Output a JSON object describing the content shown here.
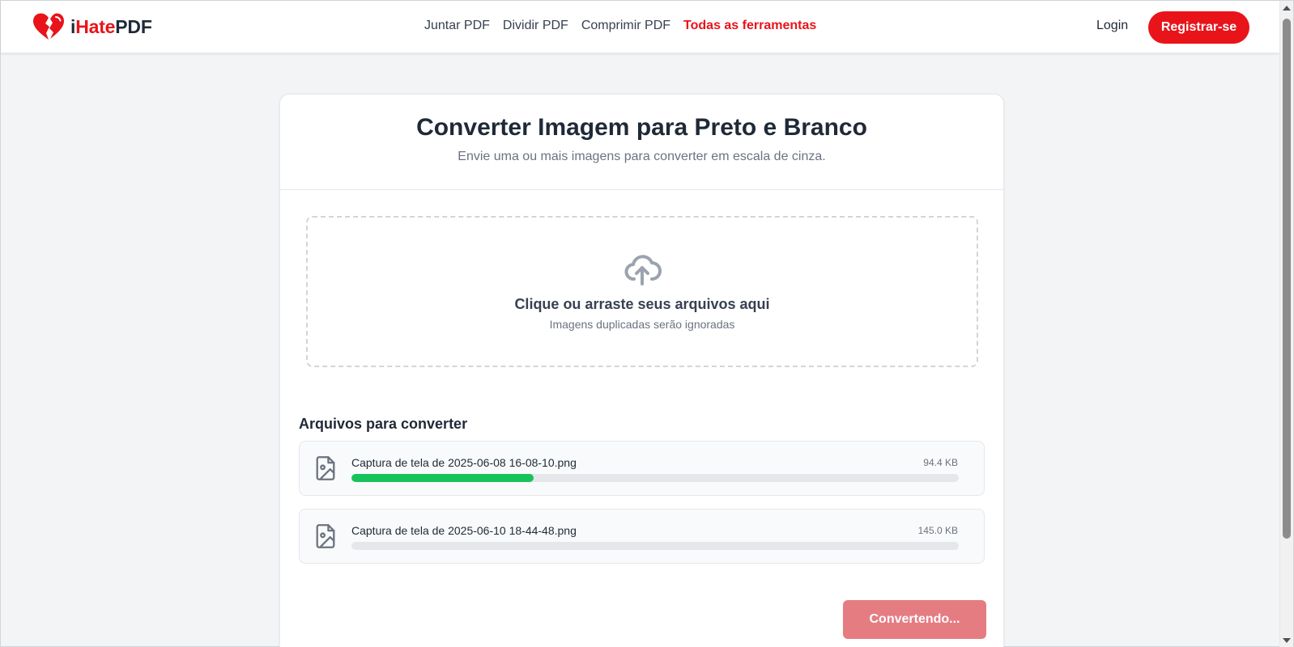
{
  "header": {
    "logo": {
      "prefix": "i",
      "accent": "Hate",
      "suffix": "PDF"
    },
    "nav": [
      {
        "label": "Juntar PDF",
        "active": false
      },
      {
        "label": "Dividir PDF",
        "active": false
      },
      {
        "label": "Comprimir PDF",
        "active": false
      },
      {
        "label": "Todas as ferramentas",
        "active": true
      }
    ],
    "login_label": "Login",
    "register_label": "Registrar-se"
  },
  "main": {
    "title": "Converter Imagem para Preto e Branco",
    "subtitle": "Envie uma ou mais imagens para converter em escala de cinza.",
    "dropzone": {
      "title": "Clique ou arraste seus arquivos aqui",
      "hint": "Imagens duplicadas serão ignoradas",
      "icon": "cloud-upload-icon"
    },
    "files_heading": "Arquivos para converter",
    "files": [
      {
        "name": "Captura de tela de 2025-06-08 16-08-10.png",
        "size": "94.4 KB",
        "progress_percent": 30,
        "icon": "image-file-icon"
      },
      {
        "name": "Captura de tela de 2025-06-10 18-44-48.png",
        "size": "145.0 KB",
        "progress_percent": 0,
        "icon": "image-file-icon"
      }
    ],
    "convert_label": "Convertendo..."
  },
  "colors": {
    "brand_red": "#e8141a",
    "progress_green": "#16c35a",
    "button_disabled": "#e57c82"
  }
}
